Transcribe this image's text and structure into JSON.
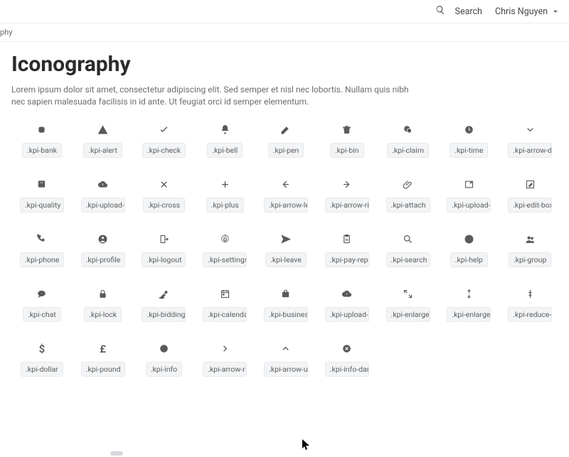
{
  "header": {
    "search_label": "Search",
    "user_name": "Chris Nguyen"
  },
  "breadcrumb": "phy",
  "page": {
    "title": "Iconography",
    "description": "Lorem ipsum dolor sit amet, consectetur adipiscing elit. Sed semper et nisl nec lobortis. Nullam quis nibh nec sapien malesuada facilisis in id ante. Ut feugiat orci id semper elementum."
  },
  "icons": [
    {
      "label": ".kpi-bank",
      "glyph": "bank"
    },
    {
      "label": ".kpi-alert",
      "glyph": "alert"
    },
    {
      "label": ".kpi-check",
      "glyph": "check"
    },
    {
      "label": ".kpi-bell",
      "glyph": "bell"
    },
    {
      "label": ".kpi-pen",
      "glyph": "pen"
    },
    {
      "label": ".kpi-bin",
      "glyph": "bin"
    },
    {
      "label": ".kpi-claim",
      "glyph": "claim"
    },
    {
      "label": ".kpi-time",
      "glyph": "time"
    },
    {
      "label": ".kpi-arrow-down",
      "glyph": "chevron-down"
    },
    {
      "label": ".kpi-quality",
      "glyph": "quality"
    },
    {
      "label": ".kpi-upload-cloud",
      "glyph": "cloud-up"
    },
    {
      "label": ".kpi-cross",
      "glyph": "cross"
    },
    {
      "label": ".kpi-plus",
      "glyph": "plus"
    },
    {
      "label": ".kpi-arrow-left",
      "glyph": "arrow-left"
    },
    {
      "label": ".kpi-arrow-right",
      "glyph": "arrow-right"
    },
    {
      "label": ".kpi-attach",
      "glyph": "attach"
    },
    {
      "label": ".kpi-upload-window",
      "glyph": "upload-window"
    },
    {
      "label": ".kpi-edit-box",
      "glyph": "edit-box"
    },
    {
      "label": ".kpi-phone",
      "glyph": "phone"
    },
    {
      "label": ".kpi-profile",
      "glyph": "profile"
    },
    {
      "label": ".kpi-logout",
      "glyph": "logout"
    },
    {
      "label": ".kpi-settings",
      "glyph": "settings"
    },
    {
      "label": ".kpi-leave",
      "glyph": "leave"
    },
    {
      "label": ".kpi-pay-report",
      "glyph": "pay-report"
    },
    {
      "label": ".kpi-search",
      "glyph": "search"
    },
    {
      "label": ".kpi-help",
      "glyph": "help"
    },
    {
      "label": ".kpi-group",
      "glyph": "group"
    },
    {
      "label": ".kpi-chat",
      "glyph": "chat"
    },
    {
      "label": ".kpi-lock",
      "glyph": "lock"
    },
    {
      "label": ".kpi-bidding",
      "glyph": "bidding"
    },
    {
      "label": ".kpi-calendar",
      "glyph": "calendar"
    },
    {
      "label": ".kpi-business",
      "glyph": "business"
    },
    {
      "label": ".kpi-upload-cloud-alt",
      "glyph": "cloud-up-solid"
    },
    {
      "label": ".kpi-enlarge",
      "glyph": "enlarge"
    },
    {
      "label": ".kpi-enlarge-v",
      "glyph": "enlarge-v"
    },
    {
      "label": ".kpi-reduce-v",
      "glyph": "reduce-v"
    },
    {
      "label": ".kpi-dollar",
      "glyph": "dollar"
    },
    {
      "label": ".kpi-pound",
      "glyph": "pound"
    },
    {
      "label": ".kpi-info",
      "glyph": "info-solid"
    },
    {
      "label": ".kpi-arrow-r",
      "glyph": "chevron-right"
    },
    {
      "label": ".kpi-arrow-u",
      "glyph": "chevron-up"
    },
    {
      "label": ".kpi-info-dark",
      "glyph": "cross-circle"
    }
  ]
}
